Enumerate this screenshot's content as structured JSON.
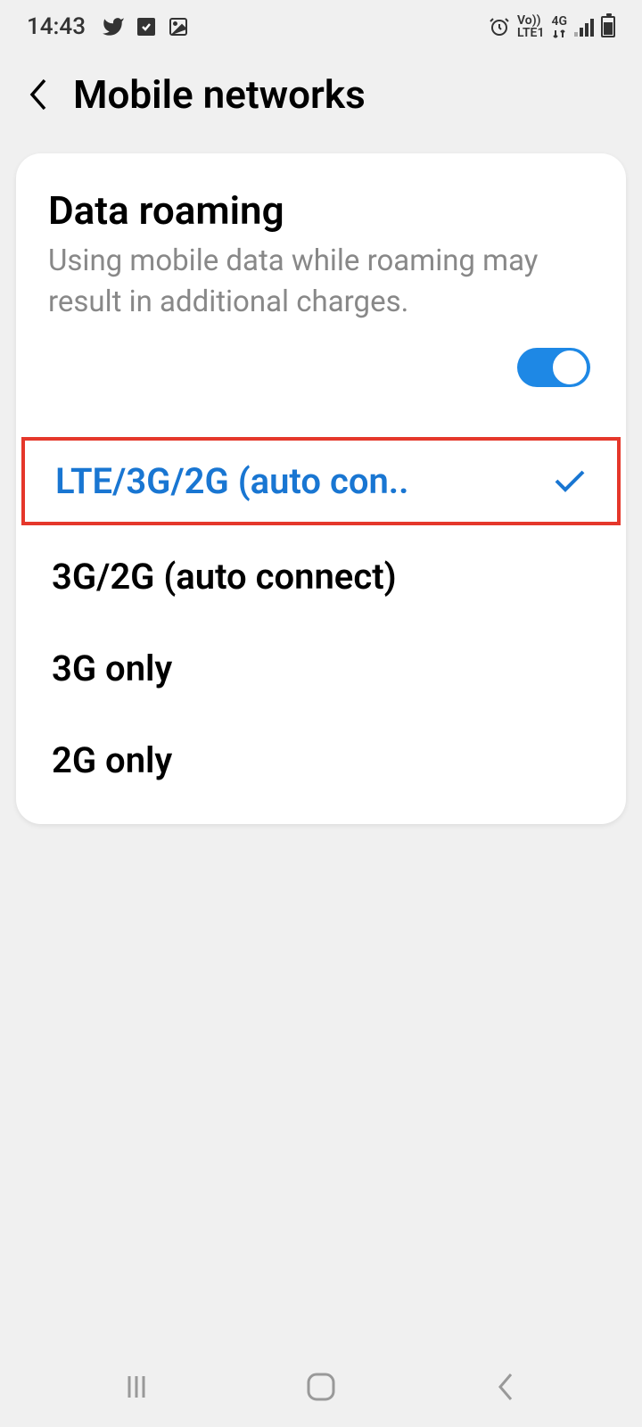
{
  "statusBar": {
    "time": "14:43",
    "network": {
      "line1": "Vo))",
      "line2": "LTE1"
    },
    "networkType": "4G"
  },
  "header": {
    "title": "Mobile networks"
  },
  "roaming": {
    "title": "Data roaming",
    "description": "Using mobile data while roaming may result in additional charges.",
    "enabled": true
  },
  "networkModes": {
    "options": [
      {
        "label": "LTE/3G/2G (auto con..",
        "selected": true,
        "highlighted": true
      },
      {
        "label": "3G/2G (auto connect)",
        "selected": false,
        "highlighted": false
      },
      {
        "label": "3G only",
        "selected": false,
        "highlighted": false
      },
      {
        "label": "2G only",
        "selected": false,
        "highlighted": false
      }
    ]
  }
}
